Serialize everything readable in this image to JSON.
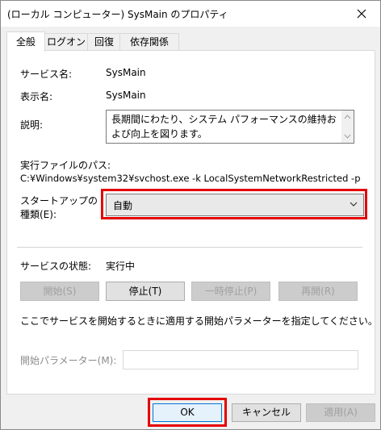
{
  "window": {
    "title": "(ローカル コンピューター) SysMain のプロパティ"
  },
  "tabs": [
    {
      "label": "全般",
      "active": true
    },
    {
      "label": "ログオン",
      "active": false
    },
    {
      "label": "回復",
      "active": false
    },
    {
      "label": "依存関係",
      "active": false
    }
  ],
  "general": {
    "service_name_label": "サービス名:",
    "service_name": "SysMain",
    "display_name_label": "表示名:",
    "display_name": "SysMain",
    "description_label": "説明:",
    "description": "長期間にわたり、システム パフォーマンスの維持および向上を図ります。",
    "exe_path_label": "実行ファイルのパス:",
    "exe_path": "C:¥Windows¥system32¥svchost.exe -k LocalSystemNetworkRestricted -p",
    "startup_type_label_line1": "スタートアップの",
    "startup_type_label_line2": "種類(E):",
    "startup_type_value": "自動",
    "status_label": "サービスの状態:",
    "status_value": "実行中",
    "buttons": {
      "start": "開始(S)",
      "stop": "停止(T)",
      "pause": "一時停止(P)",
      "resume": "再開(R)"
    },
    "hint": "ここでサービスを開始するときに適用する開始パラメーターを指定してください。",
    "params_label": "開始パラメーター(M):",
    "params_value": ""
  },
  "footer": {
    "ok": "OK",
    "cancel": "キャンセル",
    "apply": "適用(A)"
  },
  "colors": {
    "highlight": "#e40000",
    "ok_border": "#0078d7"
  }
}
